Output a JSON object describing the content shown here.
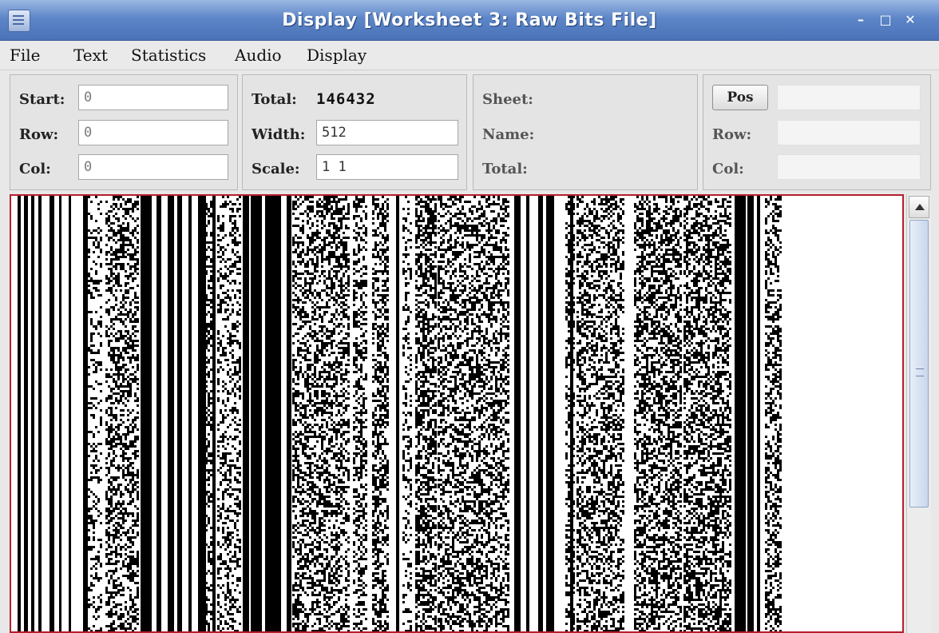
{
  "window": {
    "title": "Display [Worksheet 3: Raw Bits File]"
  },
  "menu": [
    "File",
    "Text",
    "Statistics",
    "Audio",
    "Display"
  ],
  "position_panel": {
    "start_label": "Start:",
    "start_value": "0",
    "row_label": "Row:",
    "row_value": "0",
    "col_label": "Col:",
    "col_value": "0"
  },
  "size_panel": {
    "total_label": "Total:",
    "total_value": "146432",
    "width_label": "Width:",
    "width_value": "512",
    "scale_label": "Scale:",
    "scale_value": "1 1"
  },
  "sheet_panel": {
    "sheet_label": "Sheet:",
    "name_label": "Name:",
    "total_label": "Total:"
  },
  "pos_panel": {
    "pos_button": "Pos",
    "row_label": "Row:",
    "col_label": "Col:"
  }
}
